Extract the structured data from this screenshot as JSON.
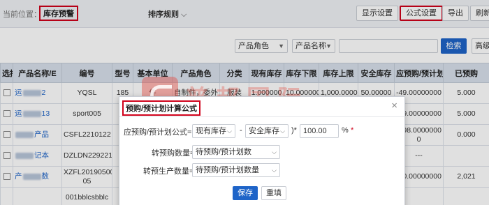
{
  "header": {
    "location_label": "当前位置：",
    "location_value": "库存预警",
    "sort_label": "排序规则",
    "buttons": {
      "display_settings": "显示设置",
      "formula_settings": "公式设置",
      "export": "导出",
      "refresh": "刷新"
    }
  },
  "filters": {
    "product_role": "产品角色",
    "product_name": "产品名称",
    "search_value": "",
    "search_button": "检索",
    "advanced_button": "高级"
  },
  "table": {
    "columns": [
      "选择",
      "产品名称/E",
      "编号",
      "型号",
      "基本单位",
      "产品角色",
      "分类",
      "现有库存",
      "库存下限",
      "库存上限",
      "安全库存",
      "应预购/预计划",
      "已预购"
    ],
    "rows": [
      {
        "name_prefix": "运",
        "name_suffix": "2",
        "code": "YQSL",
        "model": "185",
        "unit": "件",
        "role": "自制件，委外",
        "category": "服装",
        "stock": "1.000000",
        "min": "10.000000",
        "max": "1,000.0000",
        "safety": "50.00000",
        "need": "-49.00000000",
        "ordered": "5.000"
      },
      {
        "name_prefix": "运",
        "name_suffix": "13",
        "code": "sport005",
        "model": "",
        "unit": "",
        "role": "",
        "category": "",
        "stock": "",
        "min": "",
        "max": "",
        "safety": "00",
        "need": "-49.00000000",
        "ordered": "5.000"
      },
      {
        "name_prefix": "",
        "name_suffix": "产品",
        "code": "CSFL2210122",
        "model": "",
        "unit": "",
        "role": "",
        "category": "",
        "stock": "",
        "min": "",
        "max": "",
        "safety": "0",
        "need": "-598.0000000 0",
        "ordered": "0.000"
      },
      {
        "name_prefix": "",
        "name_suffix": "记本",
        "code": "DZLDN229221",
        "model": "",
        "unit": "",
        "role": "",
        "category": "",
        "stock": "",
        "min": "",
        "max": "",
        "safety": "",
        "need": "---",
        "ordered": ""
      },
      {
        "name_prefix": "产",
        "name_suffix": "数",
        "code": "XZFL20190500 05",
        "model": "",
        "unit": "",
        "role": "",
        "category": "",
        "stock": "",
        "min": "",
        "max": "",
        "safety": "00",
        "need": "-10.00000000",
        "ordered": "2,021"
      },
      {
        "name_prefix": "",
        "name_suffix": "",
        "code": "001bblcsbblc",
        "model": "",
        "unit": "",
        "role": "",
        "category": "",
        "stock": "",
        "min": "",
        "max": "",
        "safety": "",
        "need": "",
        "ordered": ""
      }
    ]
  },
  "watermark": {
    "title": "普邦国际",
    "subtitle": "数智一体化先行者"
  },
  "modal": {
    "title": "预购/预计划计算公式",
    "close": "×",
    "formula_label": "应预购/预计划公式=(",
    "select_a": "现有库存",
    "minus": "-",
    "select_b": "安全库存",
    "mult": ")*",
    "percent_value": "100.00",
    "percent_sign": "%",
    "required_mark": "*",
    "transfer_purchase_label": "转预购数量=",
    "transfer_purchase_value": "待预购/预计划数",
    "transfer_production_label": "转预生产数量=",
    "transfer_production_value": "待预购/预计划数量",
    "save": "保存",
    "reset": "重填"
  }
}
